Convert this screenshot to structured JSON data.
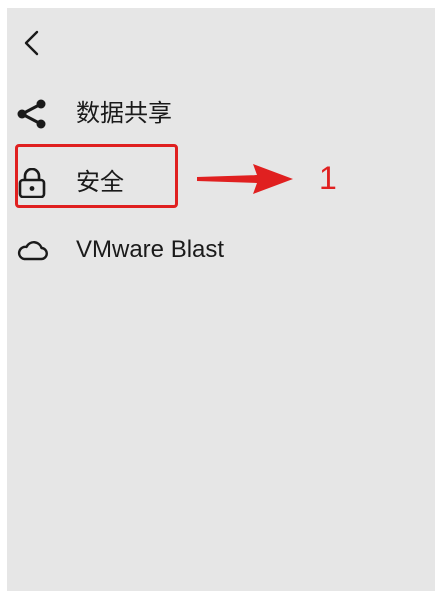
{
  "nav": {
    "items": [
      {
        "label": "数据共享",
        "icon": "share-icon"
      },
      {
        "label": "安全",
        "icon": "lock-icon"
      },
      {
        "label": "VMware Blast",
        "icon": "cloud-icon"
      }
    ]
  },
  "annotation": {
    "number": "1",
    "color": "#e02020"
  },
  "colors": {
    "panel_bg": "#e6e6e6",
    "text": "#1a1a1a"
  }
}
